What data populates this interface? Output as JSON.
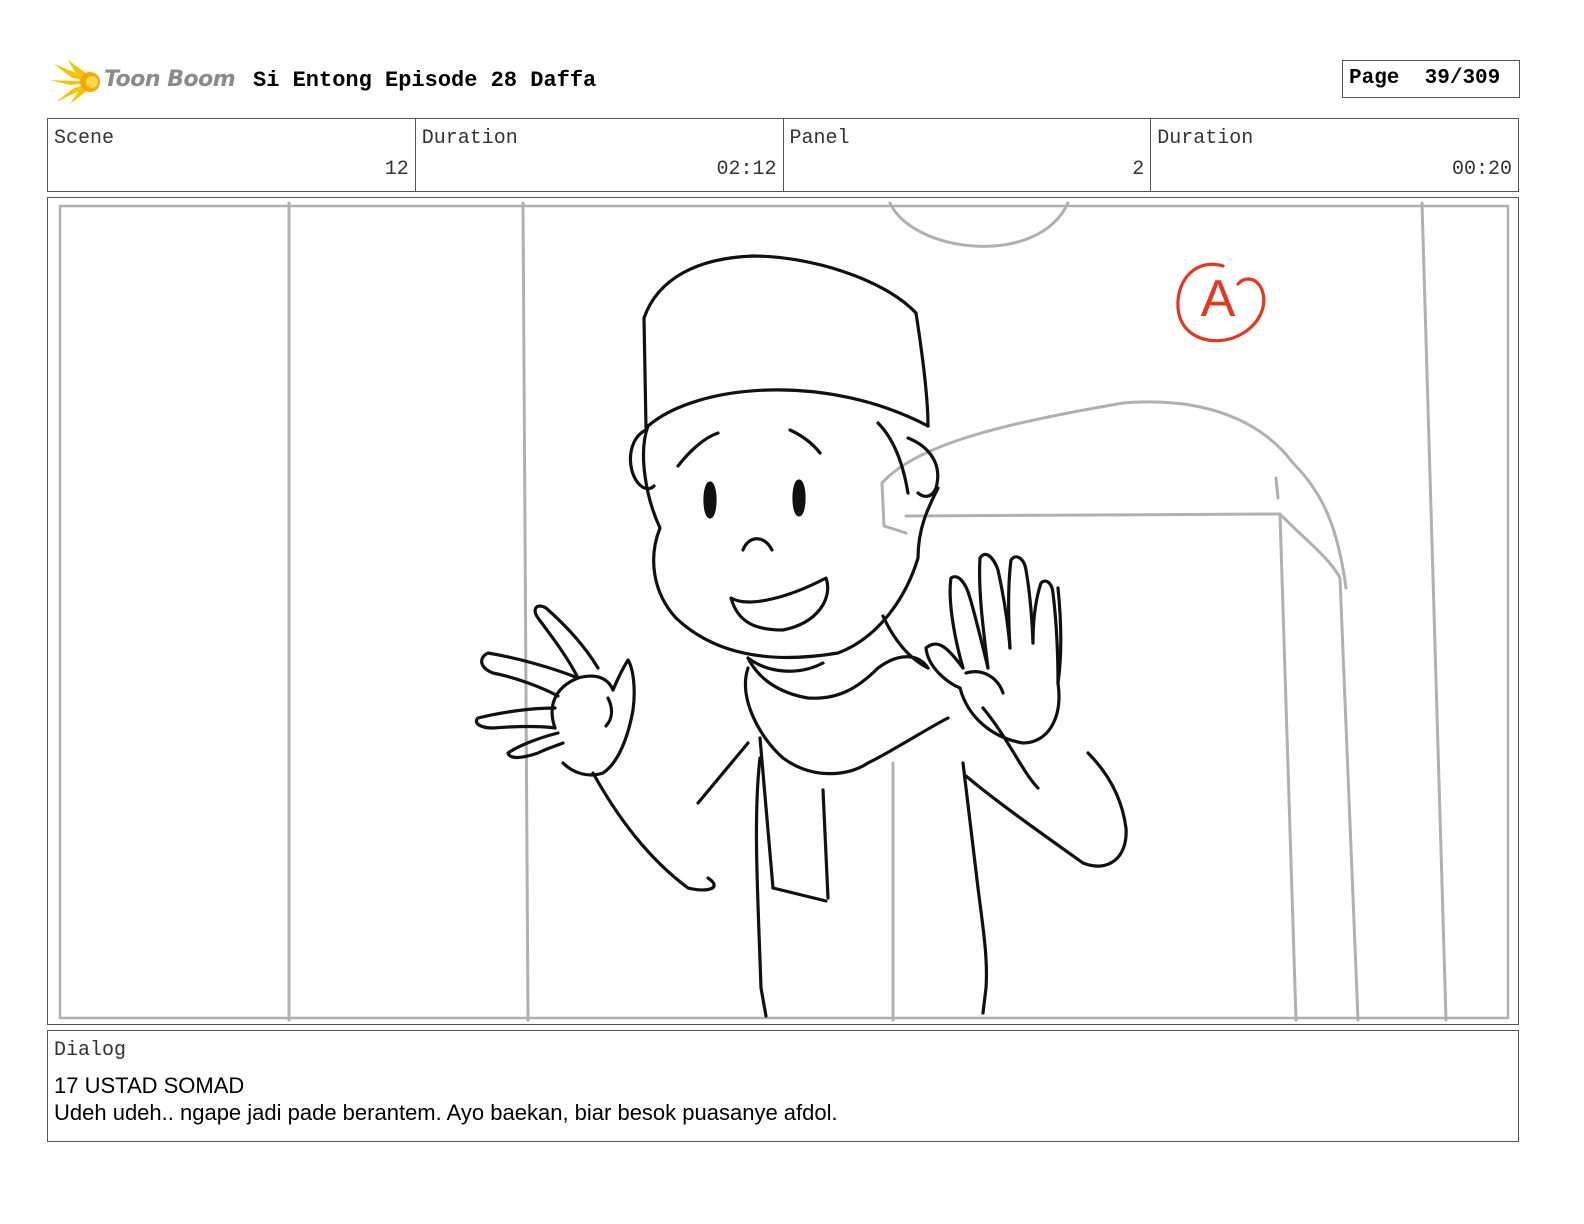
{
  "header": {
    "logo_text": "Toon Boom",
    "title": "Si Entong Episode 28 Daffa",
    "page_label": "Page",
    "page_value": "39/309"
  },
  "info": {
    "scene_label": "Scene",
    "scene_value": "12",
    "scene_duration_label": "Duration",
    "scene_duration_value": "02:12",
    "panel_label": "Panel",
    "panel_value": "2",
    "panel_duration_label": "Duration",
    "panel_duration_value": "00:20"
  },
  "sketch": {
    "marker_text": "A",
    "marker_color": "#e8351e",
    "line_color": "#111111",
    "background_line_color": "#b0b0b0"
  },
  "dialog": {
    "label": "Dialog",
    "speaker": "17 USTAD SOMAD",
    "line": "Udeh udeh.. ngape jadi pade berantem. Ayo baekan, biar besok puasanye afdol."
  },
  "colors": {
    "border": "#555555",
    "logo_flame": "#f5c400",
    "logo_text": "#8a8a8a"
  }
}
